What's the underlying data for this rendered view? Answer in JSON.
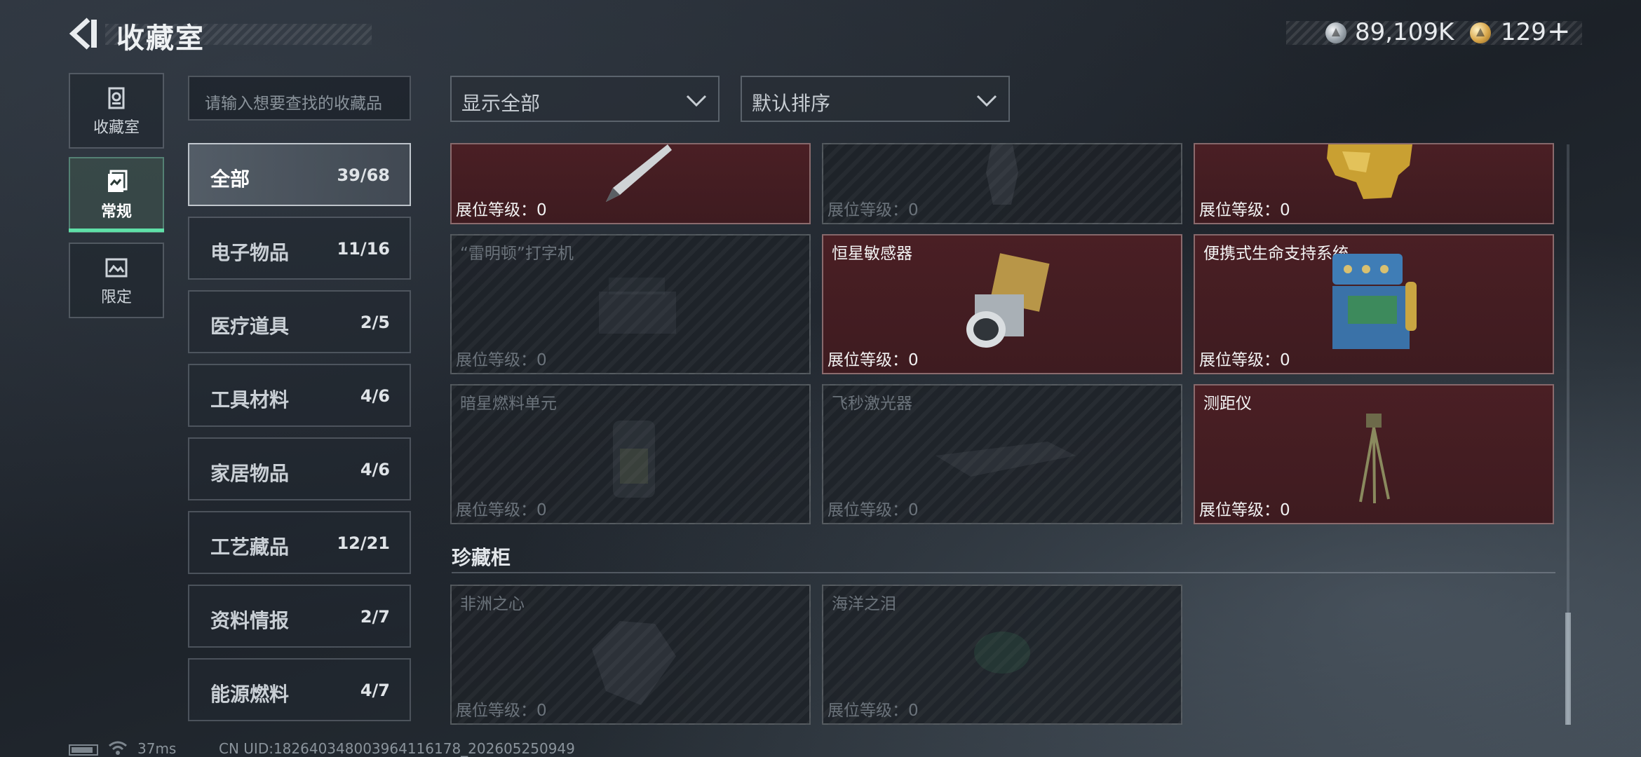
{
  "header": {
    "title": "收藏室",
    "silver_amount": "89,109K",
    "gold_amount": "129",
    "plus_label": "+"
  },
  "side_tabs": [
    {
      "label": "收藏室",
      "icon": "vault-icon"
    },
    {
      "label": "常规",
      "icon": "document-icon",
      "active": true
    },
    {
      "label": "限定",
      "icon": "image-frame-icon"
    }
  ],
  "search": {
    "placeholder": "请输入想要查找的收藏品"
  },
  "filters": {
    "display": "显示全部",
    "sort": "默认排序"
  },
  "categories": [
    {
      "label": "全部",
      "count": "39/68",
      "active": true
    },
    {
      "label": "电子物品",
      "count": "11/16"
    },
    {
      "label": "医疗道具",
      "count": "2/5"
    },
    {
      "label": "工具材料",
      "count": "4/6"
    },
    {
      "label": "家居物品",
      "count": "4/6"
    },
    {
      "label": "工艺藏品",
      "count": "12/21"
    },
    {
      "label": "资料情报",
      "count": "2/7"
    },
    {
      "label": "能源燃料",
      "count": "4/7"
    }
  ],
  "cards": [
    {
      "name": "",
      "level": "展位等级：0",
      "owned": true,
      "art": "fountain-pen-icon"
    },
    {
      "name": "",
      "level": "展位等级：0",
      "owned": false,
      "art": "vase-icon"
    },
    {
      "name": "",
      "level": "展位等级：0",
      "owned": true,
      "art": "golden-statue-icon"
    },
    {
      "name": "“雷明顿”打字机",
      "level": "展位等级：0",
      "owned": false,
      "art": "typewriter-icon"
    },
    {
      "name": "恒星敏感器",
      "level": "展位等级：0",
      "owned": true,
      "art": "star-sensor-icon"
    },
    {
      "name": "便携式生命支持系统",
      "level": "展位等级：0",
      "owned": true,
      "art": "life-support-icon"
    },
    {
      "name": "暗星燃料单元",
      "level": "展位等级：0",
      "owned": false,
      "art": "fuel-cell-icon"
    },
    {
      "name": "飞秒激光器",
      "level": "展位等级：0",
      "owned": false,
      "art": "laser-device-icon"
    },
    {
      "name": "测距仪",
      "level": "展位等级：0",
      "owned": true,
      "art": "rangefinder-tripod-icon"
    }
  ],
  "treasure_section": {
    "title": "珍藏柜",
    "cards": [
      {
        "name": "非洲之心",
        "level": "展位等级：0",
        "owned": false,
        "art": "diamond-icon"
      },
      {
        "name": "海洋之泪",
        "level": "展位等级：0",
        "owned": false,
        "art": "gem-icon"
      }
    ]
  },
  "status_bar": {
    "ping": "37ms",
    "uid": "CN UID:182640348003964116178_202605250949"
  }
}
